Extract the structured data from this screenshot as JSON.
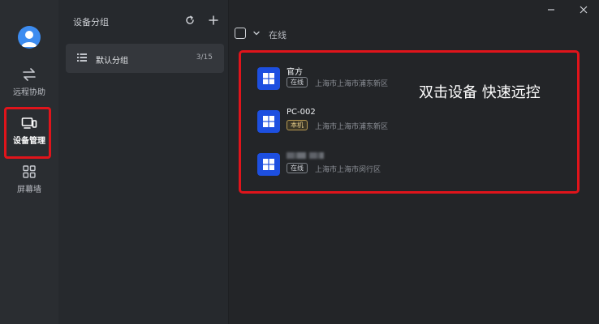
{
  "sidebar": {
    "items": [
      {
        "label": "远程协助",
        "icon": "arrows-swap-icon"
      },
      {
        "label": "设备管理",
        "icon": "devices-icon",
        "active": true
      },
      {
        "label": "屏幕墙",
        "icon": "grid-icon"
      }
    ]
  },
  "groups": {
    "title": "设备分组",
    "items": [
      {
        "name": "默认分组",
        "count": "3/15"
      }
    ]
  },
  "main": {
    "filter_label": "在线",
    "devices": [
      {
        "name": "官方",
        "badge": "在线",
        "location": "上海市上海市浦东新区"
      },
      {
        "name": "PC-002",
        "badge": "本机",
        "location": "上海市上海市浦东新区"
      },
      {
        "name": "",
        "badge": "在线",
        "location": "上海市上海市闵行区"
      }
    ],
    "overlay": "双击设备 快速远控"
  },
  "colors": {
    "accent": "#1d4fe0",
    "highlight": "#e0141b",
    "avatar": "#3d8cf0"
  }
}
